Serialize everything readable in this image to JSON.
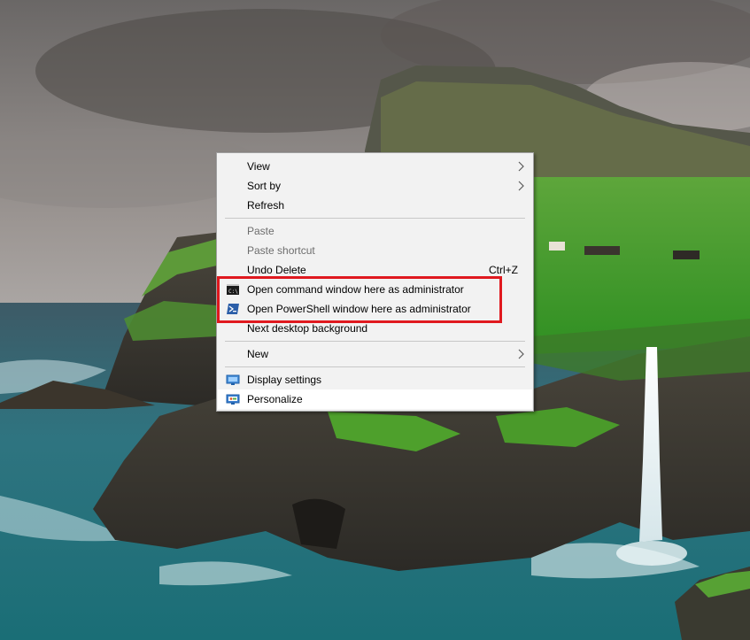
{
  "context_menu": {
    "items": [
      {
        "label": "View",
        "has_submenu": true
      },
      {
        "label": "Sort by",
        "has_submenu": true
      },
      {
        "label": "Refresh"
      },
      {
        "label": "Paste",
        "disabled": true
      },
      {
        "label": "Paste shortcut",
        "disabled": true
      },
      {
        "label": "Undo Delete",
        "shortcut": "Ctrl+Z"
      },
      {
        "label": "Open command window here as administrator",
        "icon": "cmd-icon"
      },
      {
        "label": "Open PowerShell window here as administrator",
        "icon": "powershell-icon"
      },
      {
        "label": "Next desktop background"
      },
      {
        "label": "New",
        "has_submenu": true
      },
      {
        "label": "Display settings",
        "icon": "display-settings-icon"
      },
      {
        "label": "Personalize",
        "icon": "personalize-icon",
        "highlighted": true
      }
    ]
  },
  "annotation": {
    "color": "#e0191f",
    "note": ""
  },
  "colors": {
    "menu_bg": "#f2f2f2",
    "menu_hover": "#ffffff",
    "disabled_text": "#6d6d6d"
  }
}
